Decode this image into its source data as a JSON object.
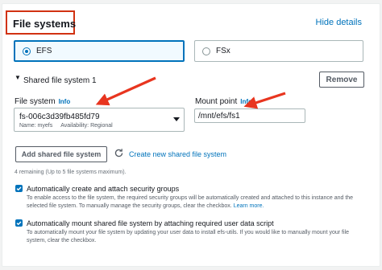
{
  "header": {
    "title": "File systems",
    "hide_link": "Hide details"
  },
  "type_options": [
    {
      "label": "EFS",
      "selected": true
    },
    {
      "label": "FSx",
      "selected": false
    }
  ],
  "shared": {
    "title": "Shared file system 1",
    "remove_label": "Remove"
  },
  "file_system_field": {
    "label": "File system",
    "info": "Info",
    "value": "fs-006c3d39fb485fd79",
    "name_meta": "Name: myefs",
    "availability_meta": "Availability: Regional"
  },
  "mount_point_field": {
    "label": "Mount point",
    "info": "Info",
    "value": "/mnt/efs/fs1"
  },
  "add_button": "Add shared file system",
  "create_link": "Create new shared file system",
  "remaining_text": "4 remaining (Up to 5 file systems maximum).",
  "checkboxes": [
    {
      "title": "Automatically create and attach security groups",
      "desc1": "To enable access to the file system, the required security groups will be automatically created and attached to this instance and the",
      "desc2": "selected file system. To manually manage the security groups, clear the checkbox.",
      "learn_more": "Learn more.",
      "checked": true
    },
    {
      "title": "Automatically mount shared file system by attaching required user data script",
      "desc1": "To automatically mount your file system by updating your user data to install efs-utils. If you would like to manually mount your file",
      "desc2": "system, clear the checkbox.",
      "checked": true
    }
  ],
  "colors": {
    "accent": "#0073bb",
    "highlight_red": "#d13212",
    "arrow_red": "#e8351f"
  }
}
